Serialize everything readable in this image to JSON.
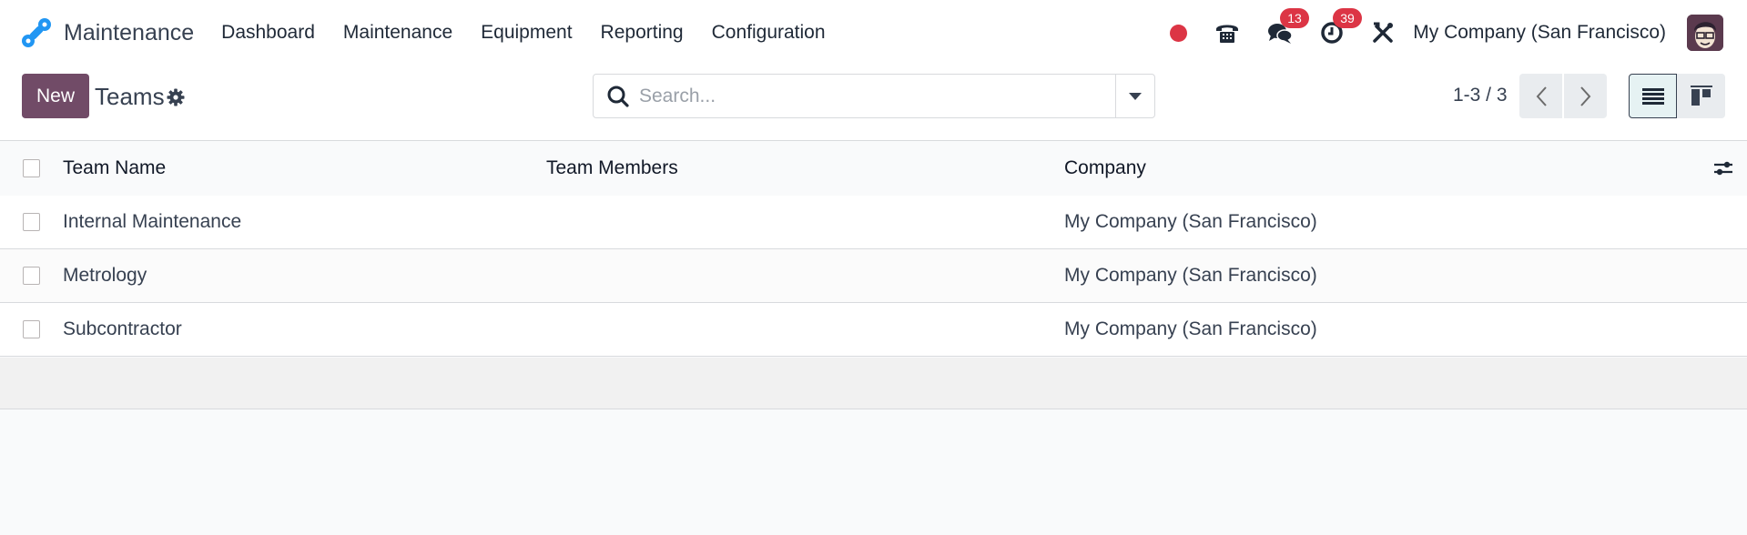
{
  "navbar": {
    "app_name": "Maintenance",
    "menu": [
      "Dashboard",
      "Maintenance",
      "Equipment",
      "Reporting",
      "Configuration"
    ],
    "systray": {
      "messages_count": "13",
      "activities_count": "39",
      "company": "My Company (San Francisco)"
    }
  },
  "control_panel": {
    "new_label": "New",
    "title": "Teams",
    "search_placeholder": "Search...",
    "pager": "1-3 / 3"
  },
  "table": {
    "columns": [
      "Team Name",
      "Team Members",
      "Company"
    ],
    "rows": [
      {
        "name": "Internal Maintenance",
        "members": "",
        "company": "My Company (San Francisco)"
      },
      {
        "name": "Metrology",
        "members": "",
        "company": "My Company (San Francisco)"
      },
      {
        "name": "Subcontractor",
        "members": "",
        "company": "My Company (San Francisco)"
      }
    ]
  },
  "colors": {
    "brand": "#714b67",
    "badge": "#dc3545",
    "logo": "#2196f3"
  }
}
